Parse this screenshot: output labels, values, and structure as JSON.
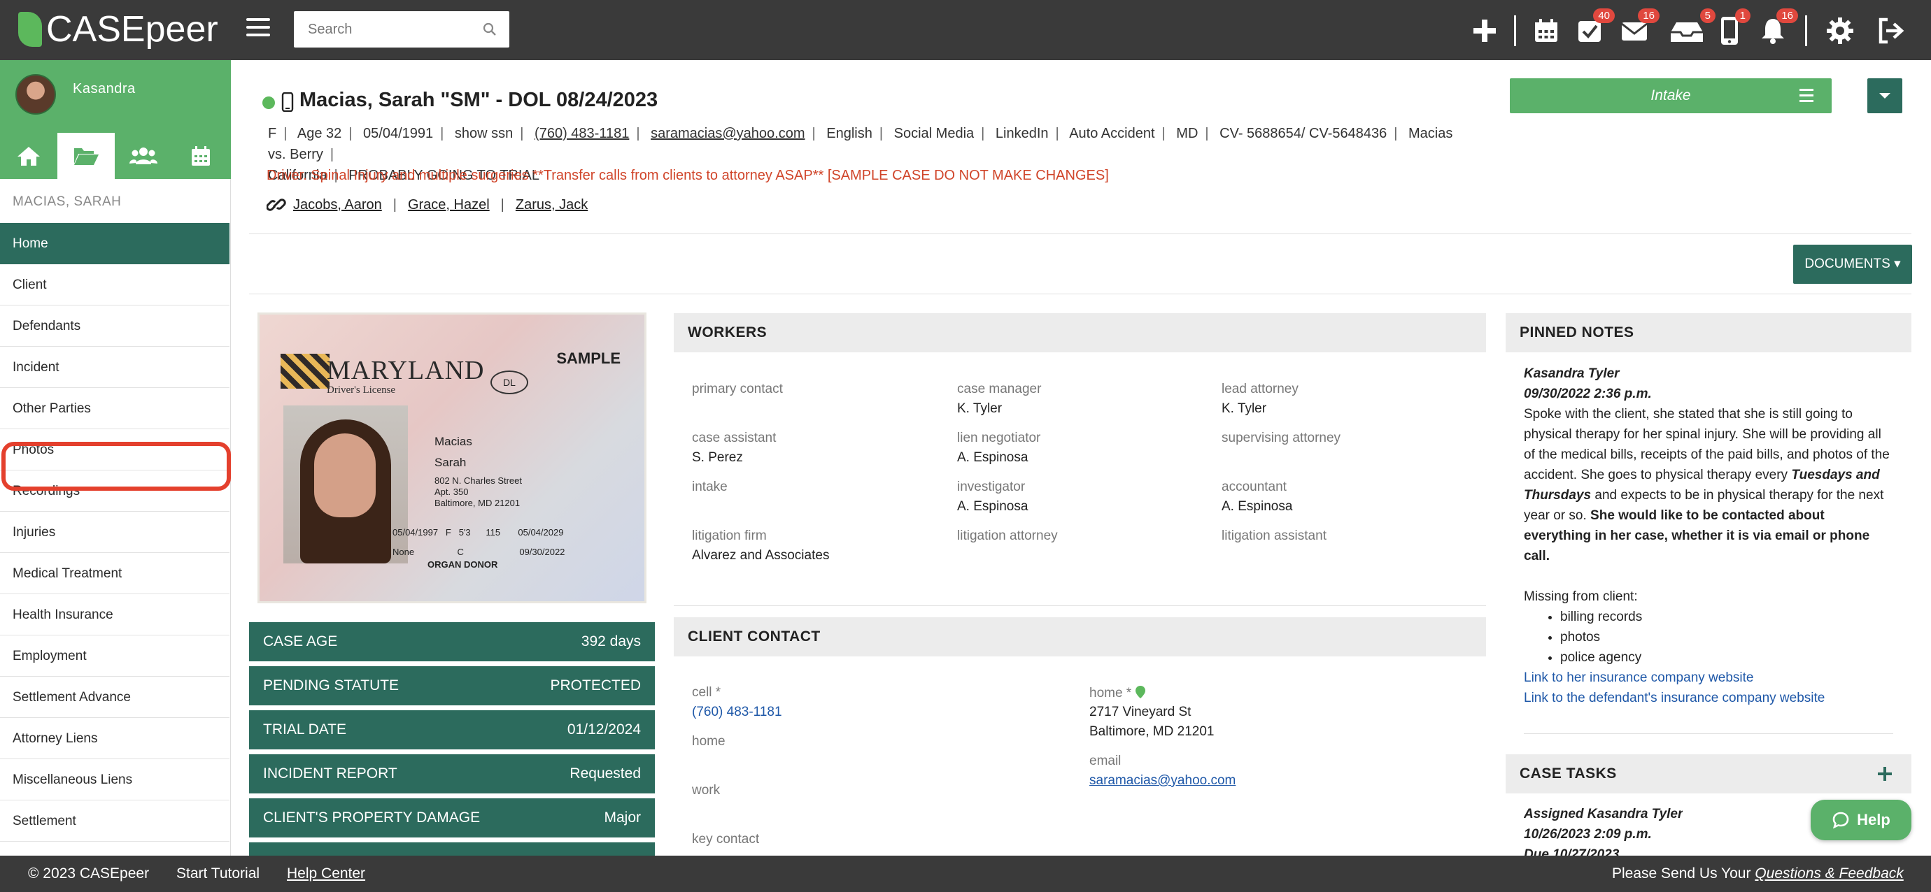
{
  "app": {
    "logo_text": "CASEpeer"
  },
  "topbar": {
    "search_placeholder": "Search",
    "badges": {
      "tasks": "40",
      "mail": "16",
      "inbox": "5",
      "phone": "1",
      "notifications": "16"
    }
  },
  "sidebar": {
    "user_name": "Kasandra",
    "case_client": "MACIAS, SARAH",
    "items": [
      "Home",
      "Client",
      "Defendants",
      "Incident",
      "Other Parties",
      "Photos",
      "Recordings",
      "Injuries",
      "Medical Treatment",
      "Health Insurance",
      "Employment",
      "Settlement Advance",
      "Attorney Liens",
      "Miscellaneous Liens",
      "Settlement"
    ]
  },
  "case": {
    "title": "Macias, Sarah \"SM\" - DOL 08/24/2023",
    "info": {
      "sex": "F",
      "age": "Age 32",
      "dob": "05/04/1991",
      "ssn": "show ssn",
      "phone": "(760) 483-1181",
      "email": "saramacias@yahoo.com",
      "language": "English",
      "source": "Social Media",
      "referral": "LinkedIn",
      "case_type": "Auto Accident",
      "state": "MD",
      "case_numbers": "CV- 5688654/ CV-5648436",
      "case_name": "Macias vs. Berry",
      "venue": "California",
      "trial_status": "PROBABLY GOING TO TRIAL"
    },
    "alert": "Driver. Spinal Injury and multiple surgeries **Transfer calls from clients to attorney ASAP** [SAMPLE CASE DO NOT MAKE CHANGES]",
    "related": [
      "Jacobs, Aaron",
      "Grace, Hazel",
      "Zarus, Jack"
    ],
    "stage_label": "Intake",
    "documents_label": "DOCUMENTS"
  },
  "license": {
    "state": "MARYLAND",
    "subtitle": "Driver's License",
    "sample": "SAMPLE",
    "dl": "DL",
    "last_name": "Macias",
    "first_name": "Sarah",
    "address1": "802 N. Charles Street",
    "address2": "Apt. 350",
    "address3": "Baltimore, MD 21201",
    "dob": "05/04/1997",
    "sex": "F",
    "height": "5'3",
    "weight": "115",
    "expires": "05/04/2029",
    "restrictions": "None",
    "class": "C",
    "issued": "09/30/2022",
    "donor": "ORGAN DONOR"
  },
  "stats": [
    {
      "label": "CASE AGE",
      "value": "392 days"
    },
    {
      "label": "PENDING STATUTE",
      "value": "PROTECTED"
    },
    {
      "label": "TRIAL DATE",
      "value": "01/12/2024"
    },
    {
      "label": "INCIDENT REPORT",
      "value": "Requested"
    },
    {
      "label": "CLIENT'S PROPERTY DAMAGE",
      "value": "Major"
    }
  ],
  "workers": {
    "heading": "WORKERS",
    "fields": [
      {
        "label": "primary contact",
        "value": ""
      },
      {
        "label": "case manager",
        "value": "K. Tyler"
      },
      {
        "label": "lead attorney",
        "value": "K. Tyler"
      },
      {
        "label": "case assistant",
        "value": "S. Perez"
      },
      {
        "label": "lien negotiator",
        "value": "A. Espinosa"
      },
      {
        "label": "supervising attorney",
        "value": ""
      },
      {
        "label": "intake",
        "value": ""
      },
      {
        "label": "investigator",
        "value": "A. Espinosa"
      },
      {
        "label": "accountant",
        "value": "A. Espinosa"
      },
      {
        "label": "litigation firm",
        "value": "Alvarez and Associates"
      },
      {
        "label": "litigation attorney",
        "value": ""
      },
      {
        "label": "litigation assistant",
        "value": ""
      }
    ]
  },
  "client_contact": {
    "heading": "CLIENT CONTACT",
    "cell_label": "cell *",
    "cell_value": "(760) 483-1181",
    "home_phone_label": "home",
    "work_label": "work",
    "key_contact_label": "key contact",
    "home_address_label": "home *",
    "home_address_line1": "2717 Vineyard St",
    "home_address_line2": "Baltimore, MD 21201",
    "email_label": "email",
    "email_value": "saramacias@yahoo.com"
  },
  "pinned_notes": {
    "heading": "PINNED NOTES",
    "author": "Kasandra Tyler",
    "date": "09/30/2022 2:36 p.m.",
    "body_1": "Spoke with the client, she stated that she is still going to physical therapy for her spinal injury. She will be providing all of the medical bills, receipts of the paid bills, and photos of the accident. She goes to physical therapy every",
    "body_em": "Tuesdays and Thursdays",
    "body_2": "and expects to be in physical therapy for the next year or so.",
    "body_bold": "She would like to be contacted about everything in her case, whether it is via email or phone call.",
    "missing_label": "Missing from client:",
    "missing_items": [
      "billing records",
      "photos",
      "police agency"
    ],
    "link1": "Link to her insurance company website",
    "link2": "Link to the defendant's insurance company website"
  },
  "case_tasks": {
    "heading": "CASE TASKS",
    "assigned": "Assigned Kasandra Tyler",
    "date": "10/26/2023 2:09 p.m.",
    "due": "Due 10/27/2023"
  },
  "help_label": "Help",
  "footer": {
    "copyright": "© 2023 CASEpeer",
    "start_tutorial": "Start Tutorial",
    "help_center": "Help Center",
    "feedback_prefix": "Please Send Us Your",
    "feedback_link": "Questions & Feedback"
  }
}
